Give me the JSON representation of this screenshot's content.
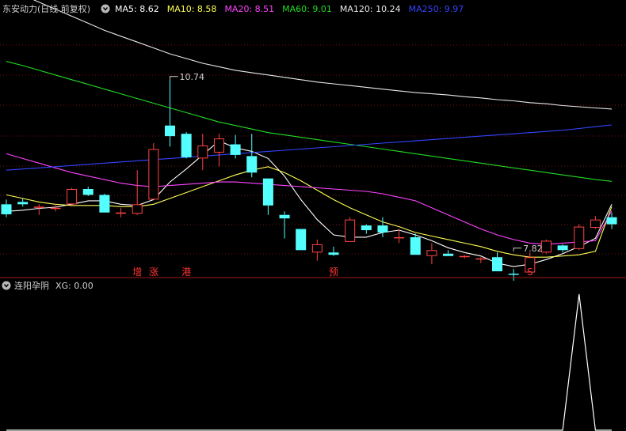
{
  "header": {
    "title": "东安动力(日线 前复权)",
    "ma_labels": [
      {
        "text": "MA5: 8.62",
        "color": "#ffffff"
      },
      {
        "text": "MA10: 8.58",
        "color": "#ffff55"
      },
      {
        "text": "MA20: 8.51",
        "color": "#ff44ff"
      },
      {
        "text": "MA60: 9.01",
        "color": "#22dd22"
      },
      {
        "text": "MA120: 10.24",
        "color": "#e8e8e8"
      },
      {
        "text": "MA250: 9.97",
        "color": "#3344ff"
      }
    ]
  },
  "indicator": {
    "title": "连阳孕阴",
    "value_label": "XG: 0.00"
  },
  "colors": {
    "background": "#000000",
    "up": "#ff4444",
    "down": "#54ffff",
    "grid": "#7a1010",
    "separator": "#a01818",
    "text": "#d0d0d0",
    "marker": "#ff3333"
  },
  "chart_data": [
    {
      "type": "candlestick",
      "scale": {
        "ylim": [
          7.4,
          11.8
        ]
      },
      "candles": [
        {
          "o": 8.62,
          "h": 8.7,
          "l": 8.4,
          "c": 8.45
        },
        {
          "o": 8.66,
          "h": 8.72,
          "l": 8.58,
          "c": 8.62
        },
        {
          "o": 8.56,
          "h": 8.62,
          "l": 8.44,
          "c": 8.58
        },
        {
          "o": 8.54,
          "h": 8.62,
          "l": 8.5,
          "c": 8.56
        },
        {
          "o": 8.62,
          "h": 8.9,
          "l": 8.58,
          "c": 8.88
        },
        {
          "o": 8.88,
          "h": 8.92,
          "l": 8.76,
          "c": 8.78
        },
        {
          "o": 8.78,
          "h": 8.8,
          "l": 8.48,
          "c": 8.48
        },
        {
          "o": 8.48,
          "h": 8.56,
          "l": 8.4,
          "c": 8.48
        },
        {
          "o": 8.46,
          "h": 9.2,
          "l": 8.44,
          "c": 8.62
        },
        {
          "o": 8.7,
          "h": 9.66,
          "l": 8.7,
          "c": 9.56
        },
        {
          "o": 9.96,
          "h": 10.74,
          "l": 9.6,
          "c": 9.78
        },
        {
          "o": 9.82,
          "h": 9.85,
          "l": 9.4,
          "c": 9.42
        },
        {
          "o": 9.4,
          "h": 9.82,
          "l": 9.2,
          "c": 9.62
        },
        {
          "o": 9.5,
          "h": 9.82,
          "l": 9.26,
          "c": 9.74
        },
        {
          "o": 9.64,
          "h": 9.8,
          "l": 9.4,
          "c": 9.46
        },
        {
          "o": 9.44,
          "h": 9.82,
          "l": 9.08,
          "c": 9.16
        },
        {
          "o": 9.06,
          "h": 9.06,
          "l": 8.44,
          "c": 8.6
        },
        {
          "o": 8.44,
          "h": 8.5,
          "l": 8.04,
          "c": 8.38
        },
        {
          "o": 8.2,
          "h": 8.2,
          "l": 7.84,
          "c": 7.84
        },
        {
          "o": 7.8,
          "h": 8.02,
          "l": 7.66,
          "c": 7.94
        },
        {
          "o": 7.8,
          "h": 7.9,
          "l": 7.74,
          "c": 7.76
        },
        {
          "o": 7.98,
          "h": 8.4,
          "l": 7.98,
          "c": 8.36
        },
        {
          "o": 8.26,
          "h": 8.28,
          "l": 8.12,
          "c": 8.18
        },
        {
          "o": 8.26,
          "h": 8.4,
          "l": 8.06,
          "c": 8.14
        },
        {
          "o": 8.04,
          "h": 8.2,
          "l": 7.96,
          "c": 8.06
        },
        {
          "o": 8.06,
          "h": 8.12,
          "l": 7.76,
          "c": 7.76
        },
        {
          "o": 7.74,
          "h": 7.96,
          "l": 7.6,
          "c": 7.84
        },
        {
          "o": 7.78,
          "h": 7.84,
          "l": 7.74,
          "c": 7.74
        },
        {
          "o": 7.72,
          "h": 7.76,
          "l": 7.7,
          "c": 7.74
        },
        {
          "o": 7.7,
          "h": 7.72,
          "l": 7.62,
          "c": 7.7
        },
        {
          "o": 7.72,
          "h": 7.8,
          "l": 7.48,
          "c": 7.48
        },
        {
          "o": 7.44,
          "h": 7.52,
          "l": 7.32,
          "c": 7.42
        },
        {
          "o": 7.46,
          "h": 7.8,
          "l": 7.46,
          "c": 7.72
        },
        {
          "o": 7.8,
          "h": 8.02,
          "l": 7.78,
          "c": 8.0
        },
        {
          "o": 7.92,
          "h": 7.94,
          "l": 7.8,
          "c": 7.84
        },
        {
          "o": 7.86,
          "h": 8.28,
          "l": 7.84,
          "c": 8.24
        },
        {
          "o": 8.22,
          "h": 8.42,
          "l": 8.2,
          "c": 8.36
        },
        {
          "o": 8.4,
          "h": 8.48,
          "l": 8.2,
          "c": 8.28
        }
      ],
      "annotations": [
        {
          "text": "10.74",
          "index": 10,
          "price": 10.74
        },
        {
          "text": "7.82",
          "index": 31,
          "price": 7.82
        }
      ],
      "bottom_markers": [
        {
          "text": "增",
          "index": 8
        },
        {
          "text": "涨",
          "index": 9
        },
        {
          "text": "港",
          "index": 11
        },
        {
          "text": "预",
          "index": 20
        },
        {
          "text": "S",
          "index": 32
        }
      ],
      "ma_series": [
        {
          "name": "MA5",
          "color": "#ffffff",
          "values": [
            8.5,
            8.52,
            8.55,
            8.57,
            8.62,
            8.68,
            8.68,
            8.62,
            8.6,
            8.7,
            9.0,
            9.22,
            9.46,
            9.7,
            9.58,
            9.52,
            9.4,
            9.1,
            8.7,
            8.36,
            8.1,
            8.06,
            8.06,
            8.14,
            8.18,
            8.1,
            8.0,
            7.88,
            7.8,
            7.74,
            7.62,
            7.56,
            7.6,
            7.68,
            7.78,
            7.9,
            8.04,
            8.62
          ]
        },
        {
          "name": "MA10",
          "color": "#ffff55",
          "values": [
            8.78,
            8.72,
            8.66,
            8.62,
            8.6,
            8.6,
            8.6,
            8.58,
            8.58,
            8.62,
            8.72,
            8.82,
            8.92,
            9.02,
            9.12,
            9.2,
            9.26,
            9.16,
            9.02,
            8.86,
            8.7,
            8.56,
            8.44,
            8.32,
            8.24,
            8.14,
            8.08,
            8.02,
            7.96,
            7.9,
            7.82,
            7.76,
            7.72,
            7.72,
            7.74,
            7.76,
            7.82,
            8.58
          ]
        },
        {
          "name": "MA20",
          "color": "#ff44ff",
          "values": [
            9.48,
            9.4,
            9.32,
            9.24,
            9.16,
            9.1,
            9.04,
            8.98,
            8.94,
            8.92,
            8.94,
            8.96,
            8.98,
            9.0,
            9.0,
            8.98,
            8.96,
            8.94,
            8.92,
            8.9,
            8.88,
            8.86,
            8.84,
            8.8,
            8.74,
            8.68,
            8.56,
            8.44,
            8.32,
            8.2,
            8.1,
            8.02,
            7.96,
            7.94,
            7.96,
            7.98,
            8.0,
            8.51
          ]
        },
        {
          "name": "MA60",
          "color": "#22dd22",
          "values": [
            11.05,
            10.98,
            10.9,
            10.82,
            10.74,
            10.66,
            10.58,
            10.5,
            10.42,
            10.34,
            10.26,
            10.18,
            10.1,
            10.02,
            9.96,
            9.9,
            9.84,
            9.8,
            9.76,
            9.72,
            9.68,
            9.64,
            9.6,
            9.56,
            9.52,
            9.48,
            9.44,
            9.4,
            9.36,
            9.32,
            9.28,
            9.24,
            9.2,
            9.16,
            9.12,
            9.08,
            9.04,
            9.01
          ]
        },
        {
          "name": "MA120",
          "color": "#e8e8e8",
          "values": [
            12.3,
            12.18,
            12.06,
            11.94,
            11.82,
            11.7,
            11.58,
            11.48,
            11.38,
            11.28,
            11.18,
            11.1,
            11.02,
            10.96,
            10.9,
            10.86,
            10.82,
            10.78,
            10.74,
            10.7,
            10.67,
            10.64,
            10.61,
            10.58,
            10.55,
            10.52,
            10.5,
            10.48,
            10.45,
            10.43,
            10.4,
            10.38,
            10.35,
            10.33,
            10.3,
            10.28,
            10.26,
            10.24
          ]
        },
        {
          "name": "MA250",
          "color": "#3344ff",
          "values": [
            9.2,
            9.22,
            9.24,
            9.26,
            9.28,
            9.3,
            9.32,
            9.34,
            9.36,
            9.38,
            9.4,
            9.42,
            9.44,
            9.46,
            9.48,
            9.5,
            9.52,
            9.54,
            9.56,
            9.58,
            9.6,
            9.62,
            9.64,
            9.66,
            9.68,
            9.7,
            9.72,
            9.74,
            9.76,
            9.78,
            9.8,
            9.82,
            9.84,
            9.86,
            9.88,
            9.91,
            9.94,
            9.97
          ]
        }
      ]
    },
    {
      "type": "line",
      "series": [
        {
          "name": "XG",
          "values": [
            0,
            0,
            0,
            0,
            0,
            0,
            0,
            0,
            0,
            0,
            0,
            0,
            0,
            0,
            0,
            0,
            0,
            0,
            0,
            0,
            0,
            0,
            0,
            0,
            0,
            0,
            0,
            0,
            0,
            0,
            0,
            0,
            0,
            0,
            0,
            1,
            0,
            0
          ]
        }
      ],
      "ylim": [
        0,
        1
      ]
    }
  ]
}
